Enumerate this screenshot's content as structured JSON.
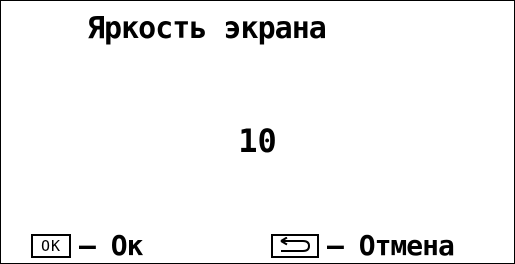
{
  "screen": {
    "title": "Яркость экрана",
    "value": "10"
  },
  "hints": {
    "ok_key_label": "OK",
    "ok_text": "– Ок",
    "cancel_text": "– Отмена"
  }
}
